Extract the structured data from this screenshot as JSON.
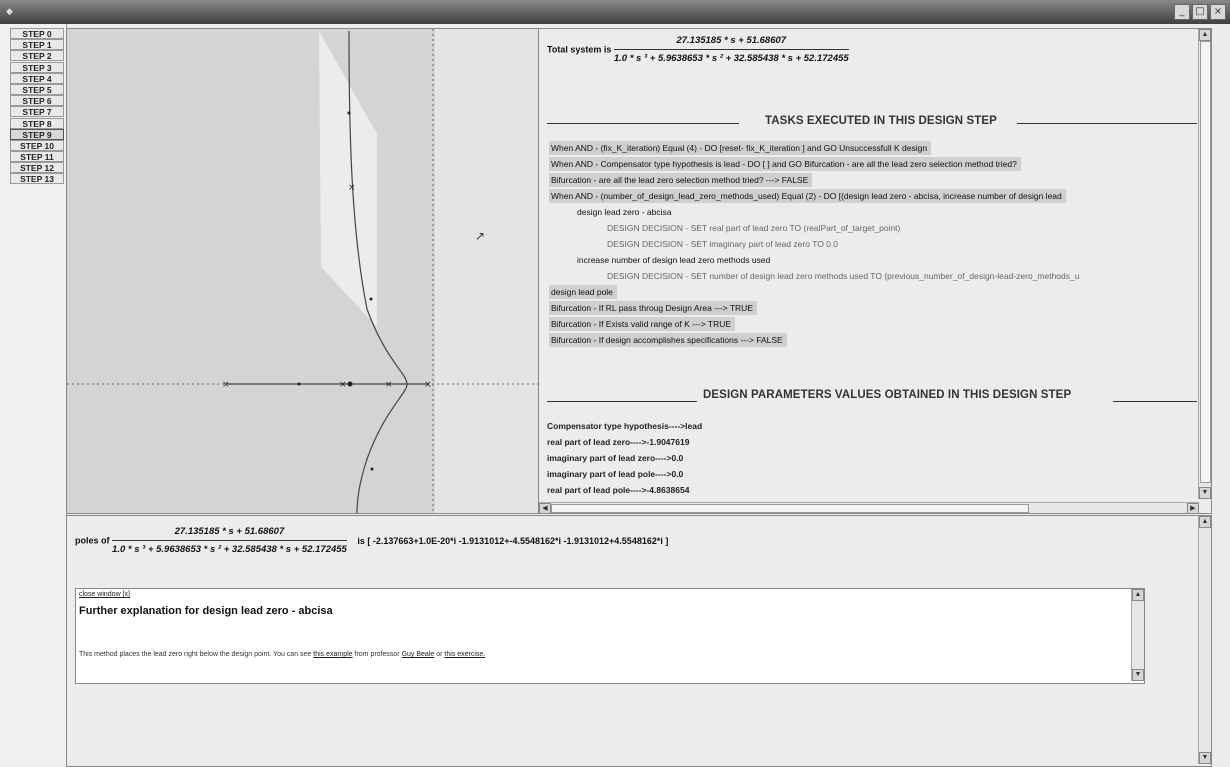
{
  "window": {
    "icon": "java-icon",
    "buttons": [
      "_",
      "□",
      "×"
    ]
  },
  "steps": [
    "STEP 0",
    "STEP 1",
    "STEP 2",
    "STEP 3",
    "STEP 4",
    "STEP 5",
    "STEP 6",
    "STEP 7",
    "STEP 8",
    "STEP 9",
    "STEP 10",
    "STEP 11",
    "STEP 12",
    "STEP 13"
  ],
  "active_step": "STEP 9",
  "total_system": {
    "label": "Total system  is",
    "numerator": "27.135185 * s + 51.68607",
    "denominator": "1.0 * s ³ + 5.9638653 * s ² + 32.585438 * s + 52.172455"
  },
  "tasks_heading": "TASKS EXECUTED IN THIS DESIGN STEP",
  "tasks": [
    {
      "text": "When AND - (fix_K_iteration)  Equal  (4) - DO [reset- fix_K_iteration ] and  GO Unsuccessfull K design",
      "indent": 0,
      "hl": true,
      "grey": false
    },
    {
      "text": "When AND - Compensator type hypothesis  is  lead - DO [ ] and  GO Bifurcation - are all the lead zero selection method tried?",
      "indent": 0,
      "hl": true,
      "grey": false
    },
    {
      "text": "Bifurcation - are all the lead zero selection method tried? ---> FALSE",
      "indent": 0,
      "hl": true,
      "grey": false
    },
    {
      "text": "When AND - (number_of_design_lead_zero_methods_used)  Equal  (2) - DO [(design lead zero - abcisa, increase number of design lead",
      "indent": 0,
      "hl": true,
      "grey": false
    },
    {
      "text": "design lead zero - abcisa",
      "indent": 1,
      "hl": false,
      "grey": false
    },
    {
      "text": "DESIGN DECISION - SET real part of lead zero  TO  (realPart_of_target_point)",
      "indent": 2,
      "hl": false,
      "grey": true
    },
    {
      "text": "DESIGN DECISION - SET imaginary part of lead zero  TO  0.0",
      "indent": 2,
      "hl": false,
      "grey": true
    },
    {
      "text": "increase number of design lead zero methods used",
      "indent": 1,
      "hl": false,
      "grey": false
    },
    {
      "text": "DESIGN DECISION - SET number of design lead zero methods used  TO  (previous_number_of_design-lead-zero_methods_u",
      "indent": 2,
      "hl": false,
      "grey": true
    },
    {
      "text": "design lead pole",
      "indent": 0,
      "hl": true,
      "grey": false
    },
    {
      "text": "Bifurcation - If RL pass throug Design Area ---> TRUE",
      "indent": 0,
      "hl": true,
      "grey": false
    },
    {
      "text": "Bifurcation - If Exists valid range of K ---> TRUE",
      "indent": 0,
      "hl": true,
      "grey": false
    },
    {
      "text": "Bifurcation - If design accomplishes specifications ---> FALSE",
      "indent": 0,
      "hl": true,
      "grey": false
    }
  ],
  "params_heading": "DESIGN PARAMETERS VALUES OBTAINED IN THIS DESIGN STEP",
  "params": [
    "Compensator type hypothesis---->lead",
    "real part of lead zero---->-1.9047619",
    "imaginary part of lead zero---->0.0",
    "imaginary part of lead pole---->0.0",
    "real part of lead pole---->-4.8638654"
  ],
  "poles": {
    "label": "poles  of",
    "numerator": "27.135185 * s + 51.68607",
    "denominator": "1.0 * s ³ + 5.9638653 * s ² + 32.585438 * s + 52.172455",
    "result": "is [ -2.137663+1.0E-20*i -1.9131012+-4.5548162*i -1.9131012+4.5548162*i  ]"
  },
  "explanation": {
    "close": "close window [x]",
    "title": "Further explanation for design lead zero - abcisa",
    "body_prefix": "This method places the lead zero right below the design point. You can see ",
    "link1": "this example",
    "body_mid1": " from professor ",
    "link2": "Guy Beale",
    "body_mid2": " or ",
    "link3": "this exercise."
  }
}
